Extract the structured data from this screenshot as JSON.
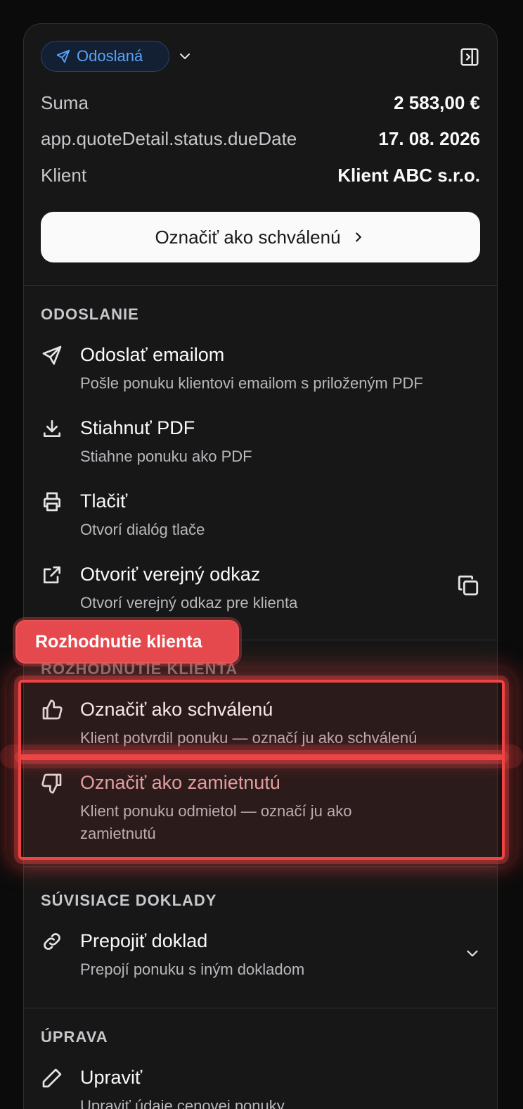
{
  "status": {
    "label": "Odoslaná",
    "color": "#5aa2f5"
  },
  "summary": [
    {
      "key": "Suma",
      "value": "2 583,00 €"
    },
    {
      "key": "app.quoteDetail.status.dueDate",
      "value": "17. 08. 2026"
    },
    {
      "key": "Klient",
      "value": "Klient ABC s.r.o."
    }
  ],
  "primary_action": {
    "label": "Označiť ako schválenú"
  },
  "sections": {
    "sending": {
      "title": "ODOSLANIE",
      "items": [
        {
          "title": "Odoslať emailom",
          "desc": "Pošle ponuku klientovi emailom s priloženým PDF",
          "icon": "send-icon"
        },
        {
          "title": "Stiahnuť PDF",
          "desc": "Stiahne ponuku ako PDF",
          "icon": "download-icon"
        },
        {
          "title": "Tlačiť",
          "desc": "Otvorí dialóg tlače",
          "icon": "printer-icon"
        },
        {
          "title": "Otvoriť verejný odkaz",
          "desc": "Otvorí verejný odkaz pre klienta",
          "icon": "external-link-icon"
        }
      ]
    },
    "decision": {
      "title": "ROZHODNUTIE KLIENTA",
      "items": [
        {
          "title": "Označiť ako schválenú",
          "desc": "Klient potvrdil ponuku — označí ju ako schválenú",
          "icon": "thumbs-up-icon"
        },
        {
          "title": "Označiť ako zamietnutú",
          "desc": "Klient ponuku odmietol — označí ju ako zamietnutú",
          "icon": "thumbs-down-icon"
        }
      ]
    },
    "related": {
      "title": "SÚVISIACE DOKLADY",
      "items": [
        {
          "title": "Prepojiť doklad",
          "desc": "Prepojí ponuku s iným dokladom",
          "icon": "link-icon"
        }
      ]
    },
    "edit": {
      "title": "ÚPRAVA",
      "items": [
        {
          "title": "Upraviť",
          "desc": "Upraviť údaje cenovej ponuky",
          "icon": "pencil-icon"
        }
      ]
    }
  },
  "highlight_tag": {
    "label": "Rozhodnutie klienta",
    "color": "#e5484d"
  }
}
